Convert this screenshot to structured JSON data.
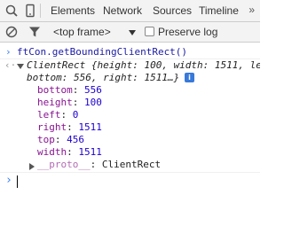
{
  "tabs": {
    "items": [
      {
        "label": "Elements"
      },
      {
        "label": "Network"
      },
      {
        "label": "Sources"
      },
      {
        "label": "Timeline"
      }
    ],
    "more": "»"
  },
  "toolbar": {
    "frame": "<top frame>",
    "preserve_log_label": "Preserve log"
  },
  "console": {
    "command": "ftCon.getBoundingClientRect()",
    "result_summary_1": "ClientRect {height: 100, width: 1511, le",
    "result_summary_2": "bottom: 556, right: 1511…}",
    "info_badge": "i",
    "properties": [
      {
        "key": "bottom",
        "value": "556"
      },
      {
        "key": "height",
        "value": "100"
      },
      {
        "key": "left",
        "value": "0"
      },
      {
        "key": "right",
        "value": "1511"
      },
      {
        "key": "top",
        "value": "456"
      },
      {
        "key": "width",
        "value": "1511"
      }
    ],
    "proto_key": "__proto__",
    "proto_value": "ClientRect"
  },
  "colors": {
    "accent": "#367cf1",
    "property_key": "#881391",
    "number": "#1c00cf"
  }
}
